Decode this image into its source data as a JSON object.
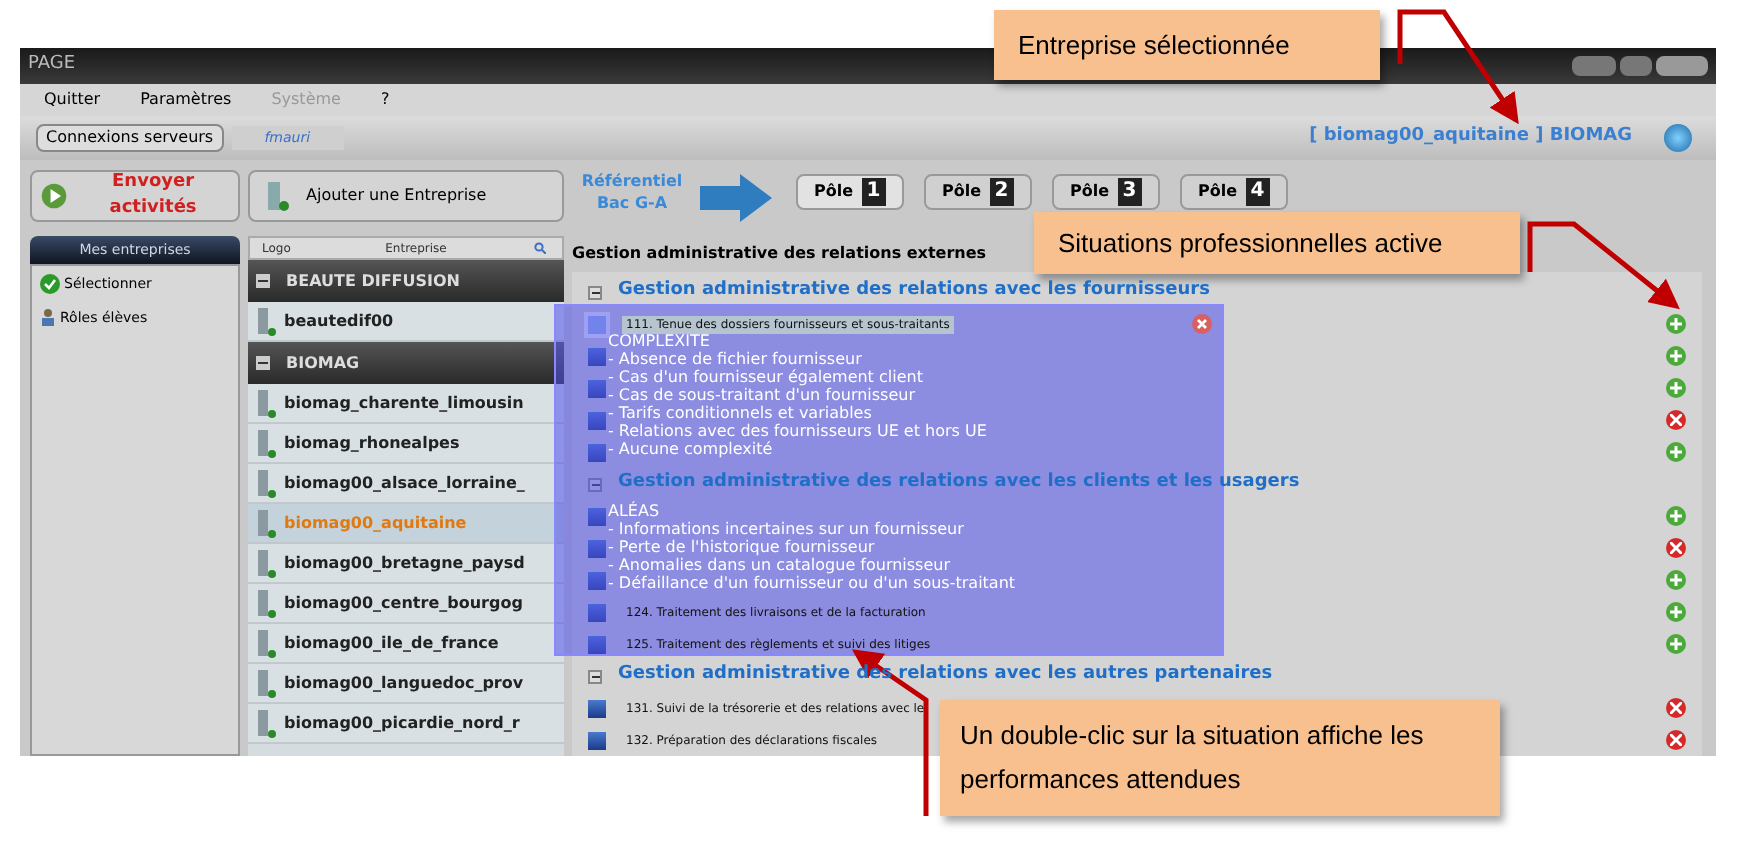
{
  "window": {
    "title": "PAGE"
  },
  "menu": [
    {
      "label": "Quitter",
      "disabled": false
    },
    {
      "label": "Paramètres",
      "disabled": false
    },
    {
      "label": "Système",
      "disabled": true
    },
    {
      "label": "?",
      "disabled": false
    }
  ],
  "toolbar": {
    "connect_button": "Connexions serveurs",
    "user": "fmauri",
    "selected_company": "[ biomag00_aquitaine ] BIOMAG"
  },
  "actions": {
    "send": "Envoyer activités",
    "add": "Ajouter une Entreprise",
    "referentiel": [
      "Référentiel",
      "Bac G-A"
    ]
  },
  "poles": [
    {
      "label": "Pôle",
      "number": "1",
      "selected": true
    },
    {
      "label": "Pôle",
      "number": "2",
      "selected": false
    },
    {
      "label": "Pôle",
      "number": "3",
      "selected": false
    },
    {
      "label": "Pôle",
      "number": "4",
      "selected": false
    }
  ],
  "left_panel": {
    "title": "Mes entreprises",
    "items": [
      {
        "label": "Sélectionner",
        "kind": "check"
      },
      {
        "label": "Rôles élèves",
        "kind": "users"
      }
    ]
  },
  "enterprise_list": {
    "columns": [
      "Logo",
      "Entreprise"
    ],
    "groups": [
      {
        "name": "BEAUTE DIFFUSION",
        "expanded": true,
        "items": [
          {
            "name": "beautedif00",
            "selected": false
          }
        ]
      },
      {
        "name": "BIOMAG",
        "expanded": true,
        "items": [
          {
            "name": "biomag_charente_limousin",
            "selected": false
          },
          {
            "name": "biomag_rhonealpes",
            "selected": false
          },
          {
            "name": "biomag00_alsace_lorraine_",
            "selected": false
          },
          {
            "name": "biomag00_aquitaine",
            "selected": true
          },
          {
            "name": "biomag00_bretagne_paysd",
            "selected": false
          },
          {
            "name": "biomag00_centre_bourgog",
            "selected": false
          },
          {
            "name": "biomag00_ile_de_france",
            "selected": false
          },
          {
            "name": "biomag00_languedoc_prov",
            "selected": false
          },
          {
            "name": "biomag00_picardie_nord_r",
            "selected": false
          }
        ]
      }
    ]
  },
  "content": {
    "title": "Gestion administrative des relations externes",
    "groups": [
      {
        "title": "Gestion administrative des relations avec les fournisseurs",
        "expanded": true,
        "situations": [
          {
            "label": "111. Tenue des dossiers fournisseurs et sous-traitants",
            "active": true,
            "selected": true
          },
          {
            "active": true,
            "selected": false
          },
          {
            "active": true,
            "selected": false
          },
          {
            "active": false,
            "selected": false
          },
          {
            "active": true,
            "selected": false
          }
        ]
      },
      {
        "title": "Gestion administrative des relations avec les clients et les usagers",
        "expanded": true,
        "situations": [
          {
            "active": true,
            "selected": false
          },
          {
            "active": false,
            "selected": false
          },
          {
            "active": true,
            "selected": false
          },
          {
            "label": "124. Traitement des livraisons et de la facturation",
            "active": true,
            "selected": false
          },
          {
            "label": "125. Traitement des règlements et suivi des litiges",
            "active": true,
            "selected": false
          }
        ]
      },
      {
        "title": "Gestion administrative des relations avec les autres partenaires",
        "expanded": true,
        "situations": [
          {
            "label": "131. Suivi de la trésorerie et des relations avec le",
            "active": false,
            "selected": false
          },
          {
            "label": "132. Préparation des déclarations fiscales",
            "active": false,
            "selected": false
          }
        ]
      }
    ]
  },
  "tooltip": {
    "sections": [
      {
        "heading": "COMPLEXITE",
        "lines": [
          "- Absence de fichier fournisseur",
          "- Cas d'un fournisseur également client",
          "- Cas de sous-traitant d'un fournisseur",
          "- Tarifs conditionnels et variables",
          "- Relations avec des fournisseurs UE et hors UE",
          "- Aucune complexité"
        ]
      },
      {
        "heading": "ALÉAS",
        "lines": [
          "- Informations incertaines sur un fournisseur",
          "- Perte de l'historique fournisseur",
          "- Anomalies dans un catalogue fournisseur",
          "- Défaillance d'un fournisseur ou d'un sous-traitant"
        ]
      }
    ]
  },
  "callouts": [
    {
      "text": "Entreprise sélectionnée"
    },
    {
      "text": "Situations professionnelles active"
    },
    {
      "text": "Un double-clic sur la situation affiche les performances attendues"
    }
  ]
}
